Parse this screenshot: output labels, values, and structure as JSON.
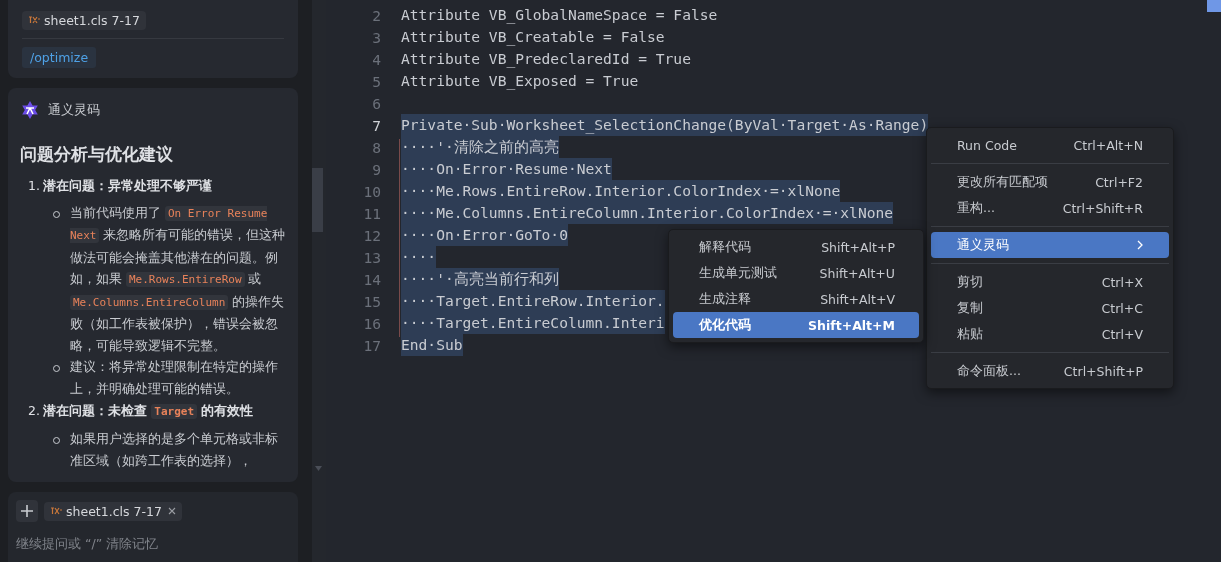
{
  "chat": {
    "request": {
      "file_chip": "sheet1.cls 7-17",
      "command": "/optimize"
    },
    "response": {
      "author": "通义灵码",
      "heading": "问题分析与优化建议",
      "items": [
        {
          "number": "1.",
          "title": [
            {
              "kind": "text",
              "text": "潜在问题：异常处理不够严谨"
            }
          ],
          "bullets": [
            [
              {
                "kind": "text",
                "text": "当前代码使用了 "
              },
              {
                "kind": "code",
                "text": "On Error Resume Next"
              },
              {
                "kind": "text",
                "text": " 来忽略所有可能的错误，但这种做法可能会掩盖其他潜在的问题。例如，如果 "
              },
              {
                "kind": "code",
                "text": "Me.Rows.EntireRow"
              },
              {
                "kind": "text",
                "text": " 或 "
              },
              {
                "kind": "code",
                "text": "Me.Columns.EntireColumn"
              },
              {
                "kind": "text",
                "text": " 的操作失败（如工作表被保护），错误会被忽略，可能导致逻辑不完整。"
              }
            ],
            [
              {
                "kind": "text",
                "text": "建议：将异常处理限制在特定的操作上，并明确处理可能的错误。"
              }
            ]
          ]
        },
        {
          "number": "2.",
          "title": [
            {
              "kind": "text",
              "text": "潜在问题：未检查 "
            },
            {
              "kind": "code",
              "text": "Target"
            },
            {
              "kind": "text",
              "text": " 的有效性"
            }
          ],
          "bullets": [
            [
              {
                "kind": "text",
                "text": "如果用户选择的是多个单元格或非标准区域（如跨工作表的选择），"
              }
            ]
          ]
        }
      ]
    },
    "input": {
      "file_chip": "sheet1.cls 7-17",
      "placeholder": "继续提问或 “/” 清除记忆"
    }
  },
  "editor": {
    "lines": [
      {
        "number": "2",
        "text": "Attribute VB_GlobalNameSpace = False",
        "selected": false,
        "current": false
      },
      {
        "number": "3",
        "text": "Attribute VB_Creatable = False",
        "selected": false,
        "current": false
      },
      {
        "number": "4",
        "text": "Attribute VB_PredeclaredId = True",
        "selected": false,
        "current": false
      },
      {
        "number": "5",
        "text": "Attribute VB_Exposed = True",
        "selected": false,
        "current": false
      },
      {
        "number": "6",
        "selected": false,
        "current": false
      },
      {
        "number": "7",
        "text": "Private·Sub·Worksheet_SelectionChange(ByVal·Target·As·Range)",
        "selected": true,
        "current": true
      },
      {
        "number": "8",
        "text": "····'·清除之前的高亮",
        "selected": true,
        "current": false
      },
      {
        "number": "9",
        "text": "····On·Error·Resume·Next",
        "selected": true,
        "current": false
      },
      {
        "number": "10",
        "text": "····Me.Rows.EntireRow.Interior.ColorIndex·=·xlNone",
        "selected": true,
        "current": false
      },
      {
        "number": "11",
        "text": "····Me.Columns.EntireColumn.Interior.ColorIndex·=·xlNone",
        "selected": true,
        "current": false
      },
      {
        "number": "12",
        "text": "····On·Error·GoTo·0",
        "selected": true,
        "current": false
      },
      {
        "number": "13",
        "text": "····",
        "selected": true,
        "current": false
      },
      {
        "number": "14",
        "text": "····'·高亮当前行和列",
        "selected": true,
        "current": false
      },
      {
        "number": "15",
        "text": "····Target.EntireRow.Interior.",
        "selected": true,
        "current": false
      },
      {
        "number": "16",
        "text": "····Target.EntireColumn.Interi",
        "selected": true,
        "current": false
      },
      {
        "number": "17",
        "text": "End·Sub",
        "selected": true,
        "current": false
      }
    ]
  },
  "context_menu": {
    "groups": [
      [
        {
          "label": "Run Code",
          "shortcut": "Ctrl+Alt+N",
          "selected": false,
          "has_submenu": false
        }
      ],
      [
        {
          "label": "更改所有匹配项",
          "shortcut": "Ctrl+F2",
          "selected": false,
          "has_submenu": false
        },
        {
          "label": "重构...",
          "shortcut": "Ctrl+Shift+R",
          "selected": false,
          "has_submenu": false
        }
      ],
      [
        {
          "label": "通义灵码",
          "selected": true,
          "has_submenu": true
        }
      ],
      [
        {
          "label": "剪切",
          "shortcut": "Ctrl+X",
          "selected": false,
          "has_submenu": false
        },
        {
          "label": "复制",
          "shortcut": "Ctrl+C",
          "selected": false,
          "has_submenu": false
        },
        {
          "label": "粘贴",
          "shortcut": "Ctrl+V",
          "selected": false,
          "has_submenu": false
        }
      ],
      [
        {
          "label": "命令面板...",
          "shortcut": "Ctrl+Shift+P",
          "selected": false,
          "has_submenu": false
        }
      ]
    ]
  },
  "submenu": {
    "items": [
      {
        "label": "解释代码",
        "shortcut": "Shift+Alt+P",
        "selected": false
      },
      {
        "label": "生成单元测试",
        "shortcut": "Shift+Alt+U",
        "selected": false
      },
      {
        "label": "生成注释",
        "shortcut": "Shift+Alt+V",
        "selected": false
      },
      {
        "label": "优化代码",
        "shortcut": "Shift+Alt+M",
        "selected": true
      }
    ]
  }
}
